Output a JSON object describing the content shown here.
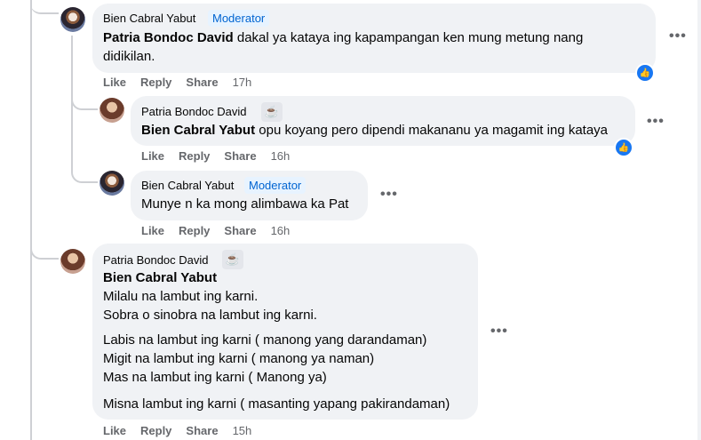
{
  "actions": {
    "like": "Like",
    "reply": "Reply",
    "share": "Share"
  },
  "comments": [
    {
      "author": "Bien Cabral Yabut",
      "badge": "Moderator",
      "mention": "Patria Bondoc David",
      "line1": "dakal ya kataya ing kapampangan ken mung metung nang",
      "line2": "didikilan.",
      "time": "17h"
    },
    {
      "author": "Patria Bondoc David",
      "badge_icon": "coffee-icon",
      "mention": "Bien Cabral Yabut",
      "line1": "opu koyang pero dipendi makananu ya magamit ing kataya",
      "time": "16h"
    },
    {
      "author": "Bien Cabral Yabut",
      "badge": "Moderator",
      "line1": "Munye n ka mong alimbawa ka Pat",
      "time": "16h"
    },
    {
      "author": "Patria Bondoc David",
      "badge_icon": "coffee-icon",
      "mention": "Bien Cabral Yabut",
      "lines": [
        "Milalu na lambut ing karni.",
        "Sobra o sinobra na lambut ing karni.",
        "Labis na lambut ing karni ( manong yang darandaman)",
        "Migit na lambut ing karni ( manong ya naman)",
        "Mas na lambut ing karni ( Manong ya)",
        "Misna lambut ing karni ( masanting yapang pakirandaman)"
      ],
      "time": "15h"
    }
  ],
  "icons": {
    "more": "more-options-icon",
    "like": "like-reaction-icon",
    "coffee": "coffee-icon"
  },
  "colors": {
    "link": "#0064d1",
    "bubble": "#f0f2f5",
    "like_blue": "#1877f2"
  }
}
